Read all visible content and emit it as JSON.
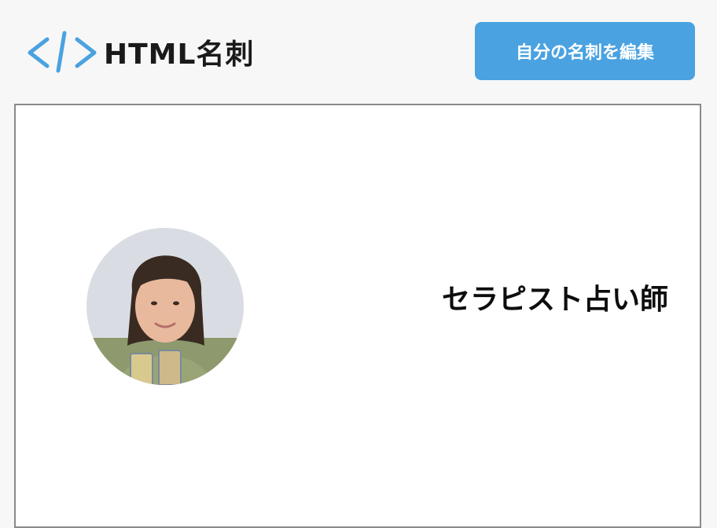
{
  "header": {
    "logo_text": "HTML名刺",
    "edit_button_label": "自分の名刺を編集"
  },
  "card": {
    "job_title": "セラピスト占い師"
  },
  "colors": {
    "accent": "#4aa2e1",
    "logo_mark": "#4aa2e1",
    "page_background": "#f7f7f7",
    "card_border": "#8a8a8a"
  },
  "icons": {
    "logo_mark": "code-brackets-icon",
    "avatar": "profile-photo"
  }
}
